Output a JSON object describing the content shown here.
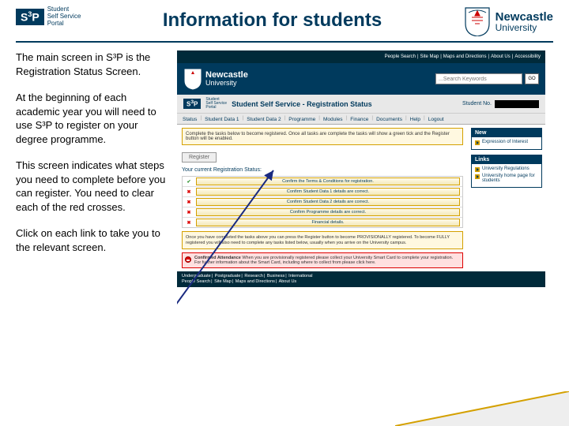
{
  "header": {
    "s3p_label": "S",
    "s3p_sup": "3",
    "s3p_label2": "P",
    "s3p_sub1": "Student",
    "s3p_sub2": "Self Service",
    "s3p_sub3": "Portal",
    "title": "Information for students",
    "ncl_name": "Newcastle",
    "ncl_uni": "University"
  },
  "para1": "The main screen in S³P is the Registration Status Screen.",
  "para2": "At the beginning of each academic year you will need to use S³P to register on your degree programme.",
  "para3": "This screen indicates what steps you need to complete before you can register. You need to clear each of the red crosses.",
  "para4": "Click on each link to take you to the relevant screen.",
  "ss": {
    "top_links": [
      "People Search",
      "Site Map",
      "Maps and Directions",
      "About Us",
      "Accessibility"
    ],
    "search_placeholder": "...Search Keywords",
    "search_go": "GO",
    "sub_title": "Student Self Service - Registration Status",
    "student_no_label": "Student No.",
    "tabs": [
      "Status",
      "Student Data 1",
      "Student Data 2",
      "Programme",
      "Modules",
      "Finance",
      "Documents",
      "Help",
      "Logout"
    ],
    "task_text": "Complete the tasks below to become registered. Once all tasks are complete the tasks will show a green tick and the Register button will be enabled.",
    "register_label": "Register",
    "reg_status_label": "Your current Registration Status:",
    "rows": [
      {
        "mark": "tick",
        "label": "Confirm the Terms & Conditions for registration."
      },
      {
        "mark": "cross",
        "label": "Confirm Student Data 1 details are correct."
      },
      {
        "mark": "cross",
        "label": "Confirm Student Data 2 details are correct."
      },
      {
        "mark": "cross",
        "label": "Confirm Programme details are correct."
      },
      {
        "mark": "cross",
        "label": "Financial details."
      }
    ],
    "info_text": "Once you have completed the tasks above you can press the Register button to become PROVISIONALLY registered. To become FULLY registered you will also need to complete any tasks listed below, usually when you arrive on the University campus.",
    "confirm_label": "Confirmed Attendance",
    "confirm_text": "When you are provisionally registered please collect your University Smart Card to complete your registration. For further information about the Smart Card, including where to collect from please click here.",
    "side_new_hd": "New",
    "side_new_item": "Expression of Interest",
    "side_links_hd": "Links",
    "side_link1": "University Regulations",
    "side_link2": "University home page for students",
    "footer_line1": [
      "Undergraduate",
      "Postgraduate",
      "Research",
      "Business",
      "International"
    ],
    "footer_line2": [
      "People Search",
      "Site Map",
      "Maps and Directions",
      "About Us"
    ]
  }
}
